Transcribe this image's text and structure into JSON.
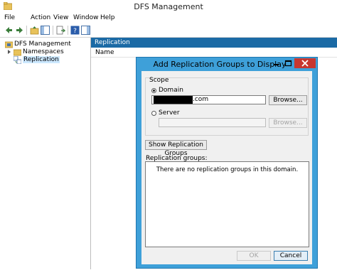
{
  "window": {
    "title": "DFS Management"
  },
  "menu": [
    "File",
    "Action",
    "View",
    "Window",
    "Help"
  ],
  "tree": {
    "root": "DFS Management",
    "namespaces": "Namespaces",
    "replication": "Replication"
  },
  "pane": {
    "header": "Replication",
    "column_name": "Name"
  },
  "dialog": {
    "title": "Add Replication Groups to Display",
    "scope_label": "Scope",
    "domain_label": "Domain",
    "domain_value_suffix": ".com",
    "domain_browse": "Browse...",
    "server_label": "Server",
    "server_value": "",
    "server_browse": "Browse...",
    "show_button": "Show Replication Groups",
    "groups_label": "Replication groups:",
    "empty_message": "There are no replication groups in this domain.",
    "ok": "OK",
    "cancel": "Cancel",
    "selected_scope": "domain"
  },
  "colors": {
    "dialog_frame": "#3ea0d9",
    "pane_header": "#1b6aa5",
    "close_button": "#c7372f",
    "selection": "#cce8ff"
  }
}
